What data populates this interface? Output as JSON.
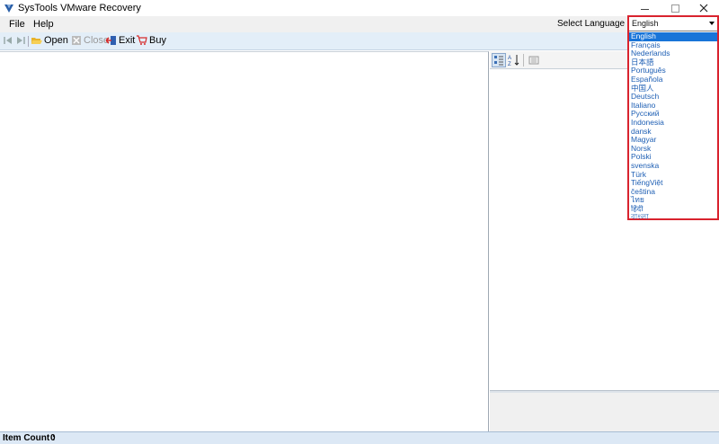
{
  "window": {
    "title": "SysTools VMware Recovery",
    "controls": {
      "minimize": "–",
      "maximize": "□",
      "close": "✕"
    }
  },
  "menu": {
    "items": [
      {
        "label": "File"
      },
      {
        "label": "Help"
      }
    ],
    "language_label": "Select Language :"
  },
  "toolbar": {
    "nav": [
      {
        "icon": "first-icon"
      },
      {
        "icon": "last-icon"
      }
    ],
    "open": "Open",
    "close": "Close",
    "exit": "Exit",
    "buy": "Buy"
  },
  "right_toolbar": {
    "buttons": [
      {
        "icon": "categorized-icon"
      },
      {
        "icon": "sort-az-icon"
      },
      {
        "icon": "properties-icon"
      }
    ]
  },
  "language": {
    "current": "English",
    "options": [
      "English",
      "Français",
      "Nederlands",
      "日本語",
      "Português",
      "Española",
      "中国人",
      "Deutsch",
      "Italiano",
      "Русский",
      "Indonesia",
      "dansk",
      "Magyar",
      "Norsk",
      "Polski",
      "svenska",
      "Türk",
      "TiếngViệt",
      "čeština",
      "ไทย",
      "हिंदी",
      "বাংলা"
    ],
    "selected_index": 0
  },
  "status": {
    "label": "Item Count :",
    "count": "0"
  },
  "colors": {
    "accent": "#1874d8",
    "highlight_border": "#d9232e",
    "toolbar_bg": "#e3eef8",
    "status_bg": "#dce8f5"
  }
}
